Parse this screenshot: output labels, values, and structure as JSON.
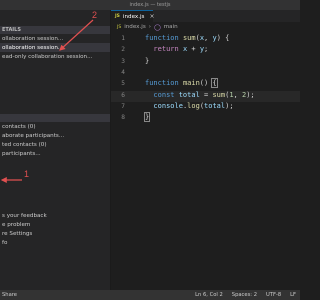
{
  "window": {
    "title": "index.js — testjs"
  },
  "sidebar": {
    "section_details": "ETAILS",
    "details_items": [
      "ollaboration session...",
      "ollaboration session...",
      "ead-only collaboration session..."
    ],
    "section_contacts": "",
    "contact_items": [
      " contacts (0)",
      "aborate participants...",
      "ted contacts (0)",
      "participants..."
    ],
    "help_items": [
      "s your feedback",
      "e problem",
      "re Settings",
      "fo"
    ]
  },
  "tabs": [
    {
      "label": "index.js",
      "icon": "JS"
    }
  ],
  "breadcrumb": {
    "file": "index.js",
    "symbol": "main",
    "separator": "›",
    "file_icon": "JS"
  },
  "code_lines": [
    {
      "num": "1",
      "parts": [
        {
          "t": "function ",
          "c": "kw"
        },
        {
          "t": "sum",
          "c": "fn"
        },
        {
          "t": "(",
          "c": "punc"
        },
        {
          "t": "x",
          "c": "var"
        },
        {
          "t": ", ",
          "c": "punc"
        },
        {
          "t": "y",
          "c": "var"
        },
        {
          "t": ") {",
          "c": "punc"
        }
      ]
    },
    {
      "num": "2",
      "parts": [
        {
          "t": "  return ",
          "c": "ctrl"
        },
        {
          "t": "x",
          "c": "var"
        },
        {
          "t": " + ",
          "c": "punc"
        },
        {
          "t": "y",
          "c": "var"
        },
        {
          "t": ";",
          "c": "punc"
        }
      ]
    },
    {
      "num": "3",
      "parts": [
        {
          "t": "}",
          "c": "punc"
        }
      ]
    },
    {
      "num": "4",
      "parts": []
    },
    {
      "num": "5",
      "parts": [
        {
          "t": "function ",
          "c": "kw"
        },
        {
          "t": "main",
          "c": "fn"
        },
        {
          "t": "() ",
          "c": "punc"
        },
        {
          "t": "{",
          "c": "punc hl"
        }
      ]
    },
    {
      "num": "6",
      "parts": [
        {
          "t": "  const ",
          "c": "kw"
        },
        {
          "t": "total",
          "c": "var"
        },
        {
          "t": " = ",
          "c": "punc"
        },
        {
          "t": "sum",
          "c": "fn"
        },
        {
          "t": "(",
          "c": "punc"
        },
        {
          "t": "1",
          "c": "num"
        },
        {
          "t": ", ",
          "c": "punc"
        },
        {
          "t": "2",
          "c": "num"
        },
        {
          "t": ");",
          "c": "punc"
        }
      ]
    },
    {
      "num": "7",
      "parts": [
        {
          "t": "  console",
          "c": "var"
        },
        {
          "t": ".",
          "c": "punc"
        },
        {
          "t": "log",
          "c": "fn"
        },
        {
          "t": "(",
          "c": "punc"
        },
        {
          "t": "total",
          "c": "var"
        },
        {
          "t": ");",
          "c": "punc"
        }
      ]
    },
    {
      "num": "8",
      "parts": [
        {
          "t": "}",
          "c": "punc hl"
        }
      ]
    }
  ],
  "status": {
    "left": "Share",
    "position": "Ln 6, Col 2",
    "spaces": "Spaces: 2",
    "encoding": "UTF-8",
    "eol": "LF"
  },
  "callouts": {
    "one": "1",
    "two": "2",
    "color": "#e05050"
  },
  "colors": {
    "editor_bg": "#1e1e1e",
    "sidebar_bg": "#252526",
    "accent": "#0e639c"
  }
}
